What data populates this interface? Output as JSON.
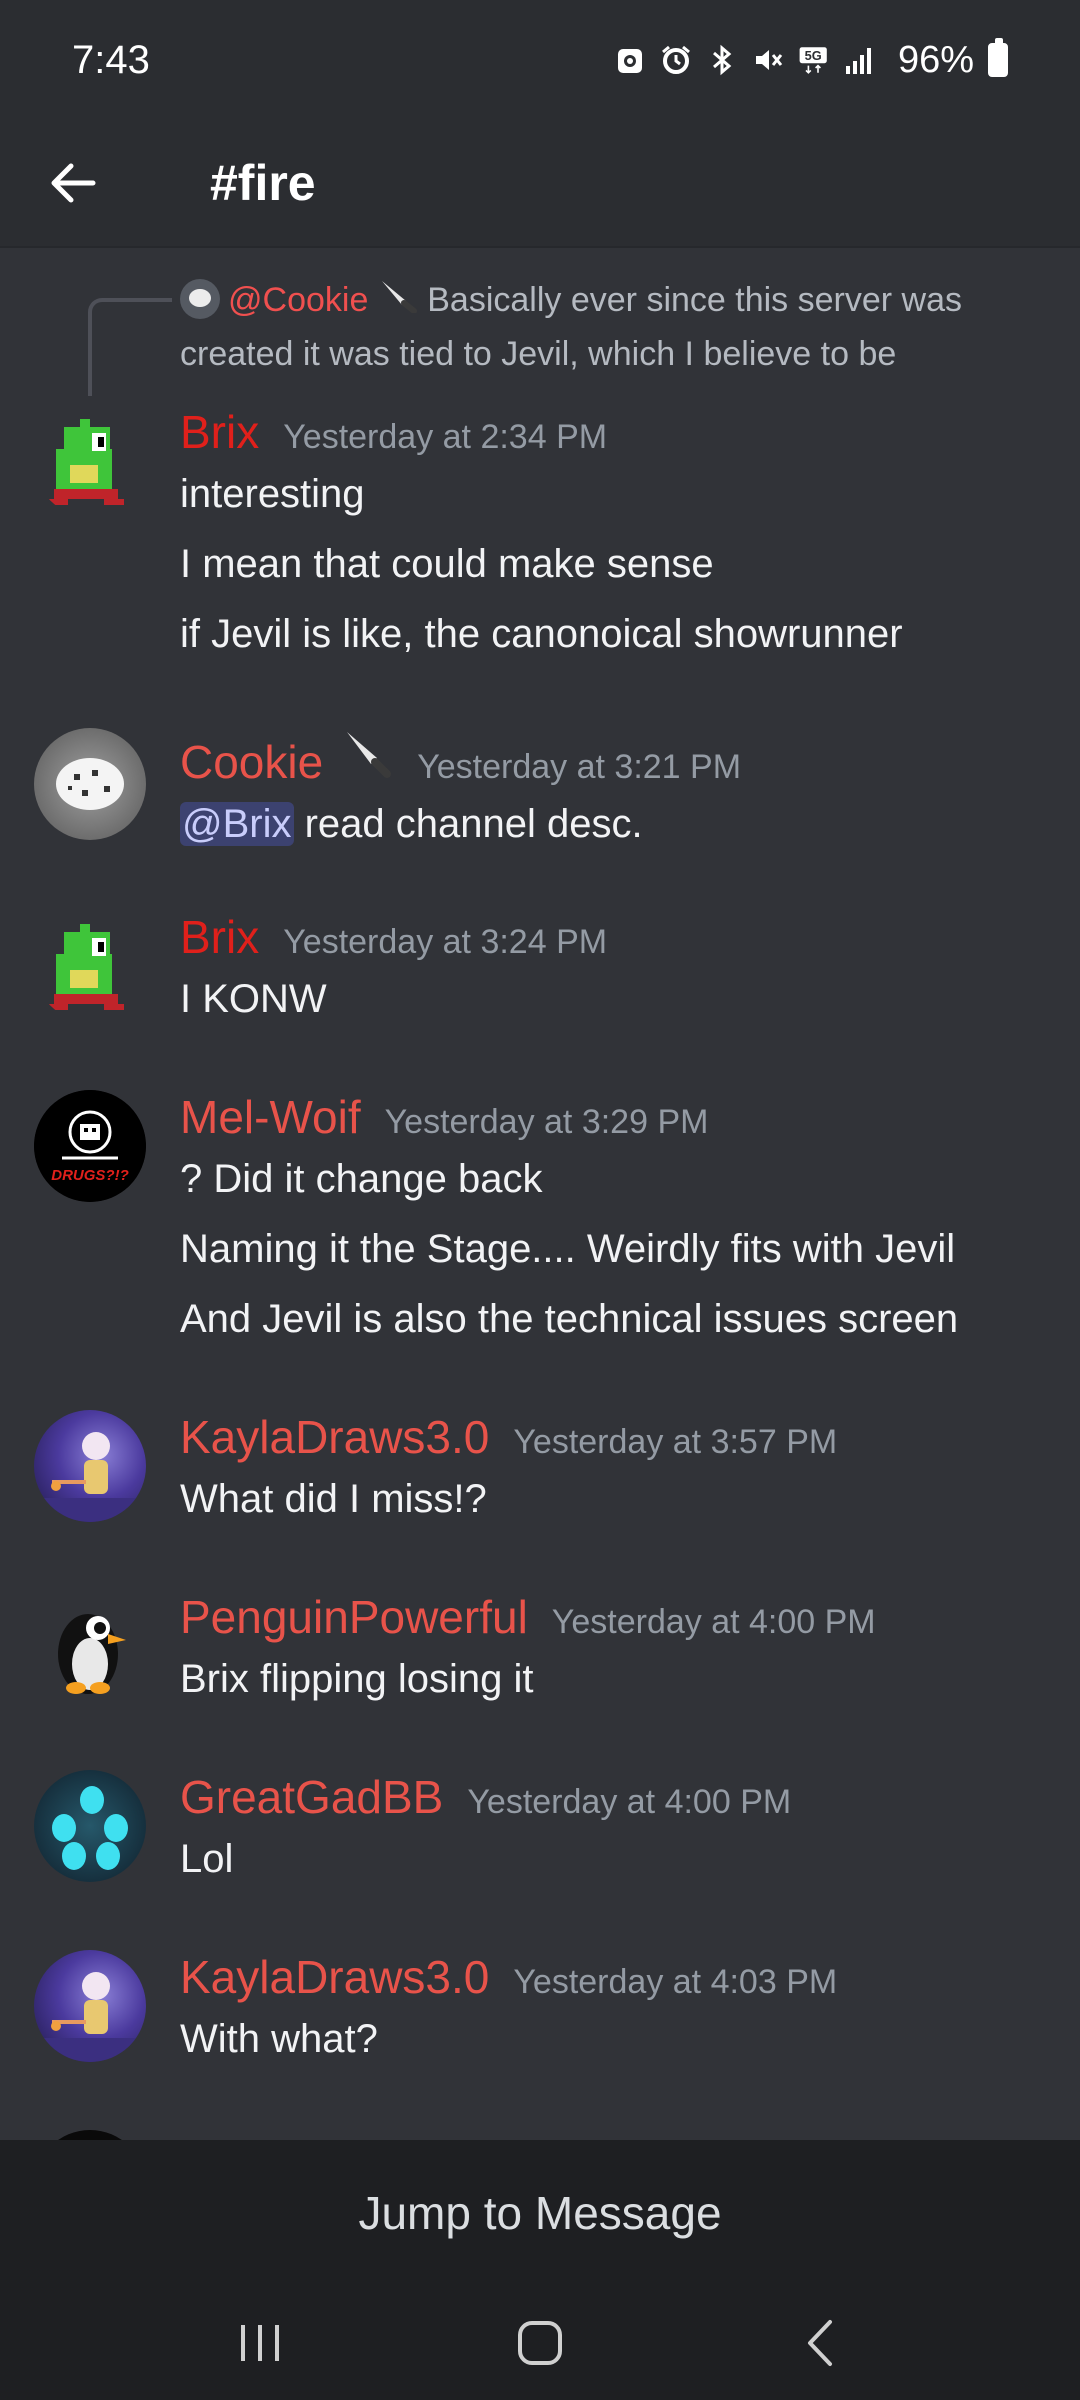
{
  "status_bar": {
    "time": "7:43",
    "network": "5G",
    "battery_percent": "96%",
    "icons": [
      "photo-saver-icon",
      "alarm-icon",
      "bluetooth-icon",
      "mute-icon",
      "5g-icon",
      "signal-icon",
      "battery-icon"
    ]
  },
  "header": {
    "channel": "#fire"
  },
  "reply": {
    "author": "@Cookie",
    "text_line1": " Basically ever since this server was",
    "text_line2": "created it was tied to Jevil, which I believe to be"
  },
  "messages": [
    {
      "author": "Brix",
      "time": "Yesterday at 2:34 PM",
      "lines": [
        "interesting",
        "I mean that could make sense",
        "if Jevil is like, the canonoical showrunner"
      ]
    },
    {
      "author": "Cookie",
      "time": "Yesterday at 3:21 PM",
      "mention": "@Brix",
      "text": " read channel desc."
    },
    {
      "author": "Brix",
      "time": "Yesterday at 3:24 PM",
      "lines": [
        "I KONW"
      ]
    },
    {
      "author": "Mel-Woif",
      "time": "Yesterday at 3:29 PM",
      "lines": [
        "? Did it change back",
        "Naming it the Stage.... Weirdly fits with Jevil",
        "And Jevil is also the technical issues screen"
      ],
      "avatar_caption": "DRUGS?!?"
    },
    {
      "author": "KaylaDraws3.0",
      "time": "Yesterday at 3:57 PM",
      "lines": [
        "What did I miss!?"
      ]
    },
    {
      "author": "PenguinPowerful",
      "time": "Yesterday at 4:00 PM",
      "lines": [
        "Brix flipping losing it"
      ]
    },
    {
      "author": "GreatGadBB",
      "time": "Yesterday at 4:00 PM",
      "lines": [
        "Lol"
      ]
    },
    {
      "author": "KaylaDraws3.0",
      "time": "Yesterday at 4:03 PM",
      "lines": [
        "With what?"
      ]
    }
  ],
  "jump_bar": {
    "label": "Jump to Message"
  },
  "nav_bar": {
    "buttons": [
      "recents-icon",
      "home-icon",
      "back-icon"
    ]
  },
  "colors": {
    "background": "#313338",
    "header": "#2b2d31",
    "username": "#e8534a",
    "username_brix": "#e0201b",
    "timestamp": "#949ba4",
    "mention_bg": "#3c4270"
  }
}
